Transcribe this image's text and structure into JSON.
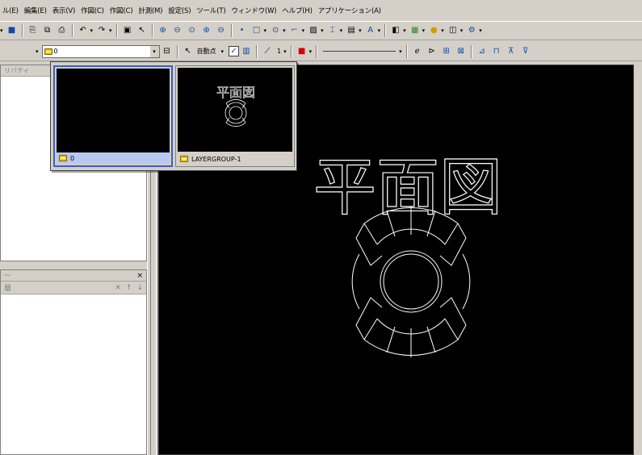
{
  "menu": [
    "ル(E)",
    "編集(E)",
    "表示(V)",
    "作図(C)",
    "作図(C)",
    "計測(M)",
    "設定(S)",
    "ツール(T)",
    "ウィンドウ(W)",
    "ヘルプ(H)",
    "アプリケーション(A)"
  ],
  "toolbar2": {
    "layer_value": "0",
    "snap_mode": "自動点",
    "line_weight": "1"
  },
  "left_panel": {
    "properties_title": "リパティ",
    "bottom_title": "〜",
    "bottom_close": "×",
    "bottom_tool_label": "層",
    "bottom_tools": [
      "✕",
      "↑",
      "↓"
    ]
  },
  "layer_popup": {
    "items": [
      {
        "label": "0",
        "selected": true
      },
      {
        "label": "LAYERGROUP-1",
        "selected": false
      }
    ],
    "thumbnail_text": "平面図"
  },
  "drawing": {
    "title_text": "平面図"
  },
  "colors": {
    "canvas_bg": "#000000",
    "stroke": "#ffffff",
    "selection": "#3a5ec8",
    "ui_face": "#d4d0c8"
  }
}
